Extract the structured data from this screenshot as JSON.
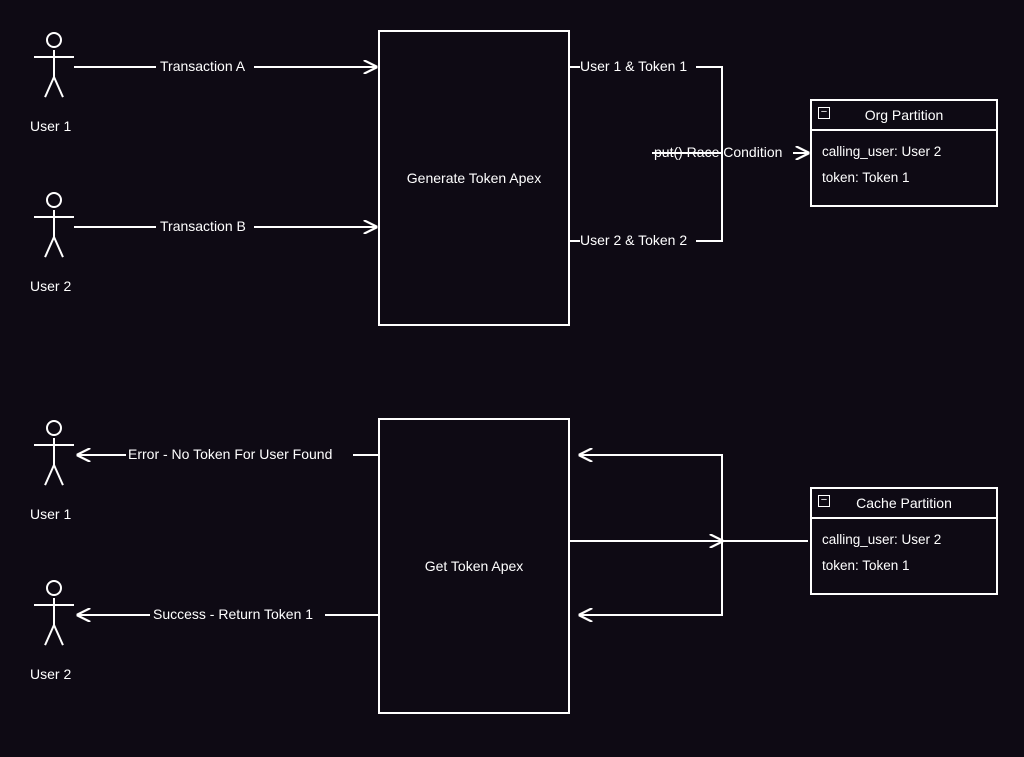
{
  "actors": {
    "user1_top": "User 1",
    "user2_top": "User 2",
    "user1_bottom": "User 1",
    "user2_bottom": "User 2"
  },
  "boxes": {
    "generate_token": "Generate Token Apex",
    "get_token": "Get Token Apex"
  },
  "top_flows": {
    "transaction_a": "Transaction A",
    "transaction_b": "Transaction B",
    "out_user1_token1": "User 1 & Token 1",
    "out_user2_token2": "User 2 & Token 2",
    "race_condition": "put() Race Condition"
  },
  "bottom_flows": {
    "error_msg": "Error - No Token For User Found",
    "success_msg": "Success - Return Token 1"
  },
  "org_partition": {
    "title": "Org Partition",
    "line1": "calling_user: User 2",
    "line2": "token: Token 1"
  },
  "cache_partition": {
    "title": "Cache Partition",
    "line1": "calling_user: User 2",
    "line2": "token: Token 1"
  },
  "icons": {
    "minus": "−"
  }
}
